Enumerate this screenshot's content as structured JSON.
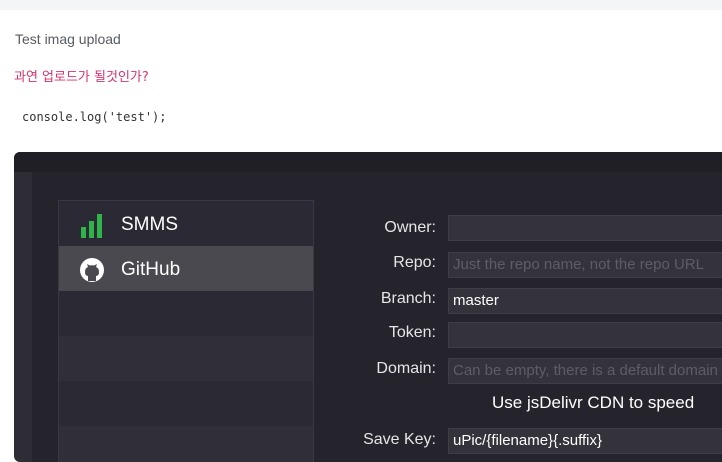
{
  "post": {
    "title": "Test imag upload",
    "korean": "과연 업로드가 될것인가?",
    "code": "console.log('test');"
  },
  "sidebar": {
    "items": [
      {
        "label": "SMMS",
        "icon": "signal-bars-icon"
      },
      {
        "label": "GitHub",
        "icon": "github-icon"
      }
    ]
  },
  "form": {
    "owner": {
      "label": "Owner:",
      "value": "",
      "placeholder": ""
    },
    "repo": {
      "label": "Repo:",
      "value": "",
      "placeholder": "Just the repo name, not the repo URL"
    },
    "branch": {
      "label": "Branch:",
      "value": "master"
    },
    "token": {
      "label": "Token:",
      "value": ""
    },
    "domain": {
      "label": "Domain:",
      "value": "",
      "placeholder": "Can be empty, there is a default domain"
    },
    "cdn_label": "Use jsDelivr CDN to speed",
    "save_key": {
      "label": "Save Key:",
      "value": "uPic/{filename}{.suffix}"
    }
  },
  "colors": {
    "accent_green": "#2fb34a",
    "korean_text": "#d6336c",
    "app_bg": "#25232c"
  }
}
